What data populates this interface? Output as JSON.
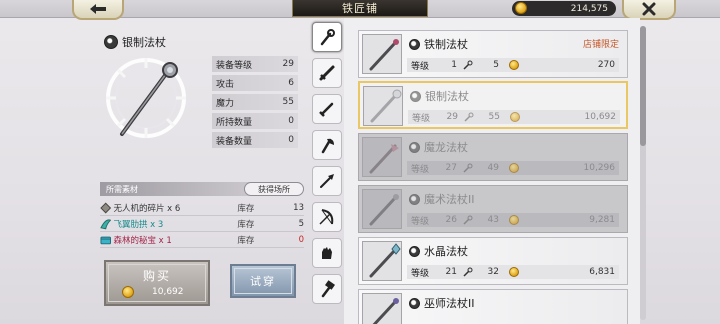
{
  "header": {
    "title": "铁匠铺",
    "currency_amount": "214,575"
  },
  "detail": {
    "item_name": "银制法杖",
    "stats": [
      {
        "label": "装备等级",
        "value": "29"
      },
      {
        "label": "攻击",
        "value": "6"
      },
      {
        "label": "魔力",
        "value": "55"
      },
      {
        "label": "所持数量",
        "value": "0"
      },
      {
        "label": "装备数量",
        "value": "0"
      }
    ]
  },
  "materials": {
    "header": "所需素材",
    "source_button": "获得场所",
    "stock_label": "库存",
    "items": [
      {
        "name": "无人机的碎片 x 6",
        "stock": "13",
        "color": "white"
      },
      {
        "name": "飞翼肋拱 x 3",
        "stock": "5",
        "color": "green"
      },
      {
        "name": "森林的秘宝 x 1",
        "stock": "0",
        "color": "red"
      }
    ]
  },
  "actions": {
    "buy_label": "购买",
    "buy_price": "10,692",
    "try_label": "试穿"
  },
  "tabs": [
    "staff",
    "sword",
    "dagger",
    "axe",
    "spear",
    "bow",
    "gauntlet",
    "hammer"
  ],
  "list": {
    "level_label": "等级",
    "items": [
      {
        "name": "铁制法杖",
        "level": "1",
        "attack": "5",
        "price": "270",
        "state": "normal",
        "tag": "店铺限定"
      },
      {
        "name": "银制法杖",
        "level": "29",
        "attack": "55",
        "price": "10,692",
        "state": "selected",
        "tag": ""
      },
      {
        "name": "魔龙法杖",
        "level": "27",
        "attack": "49",
        "price": "10,296",
        "state": "dim",
        "tag": ""
      },
      {
        "name": "魔术法杖II",
        "level": "26",
        "attack": "43",
        "price": "9,281",
        "state": "dim",
        "tag": ""
      },
      {
        "name": "水晶法杖",
        "level": "21",
        "attack": "32",
        "price": "6,831",
        "state": "normal",
        "tag": ""
      },
      {
        "name": "巫师法杖II",
        "level": "",
        "attack": "",
        "price": "",
        "state": "normal",
        "tag": ""
      }
    ]
  },
  "colors": {
    "limited_tag": "#c7582a",
    "selected_border": "#e9c763",
    "material_green": "#138a8a",
    "material_red": "#a22448",
    "stock_red": "#c62626"
  }
}
